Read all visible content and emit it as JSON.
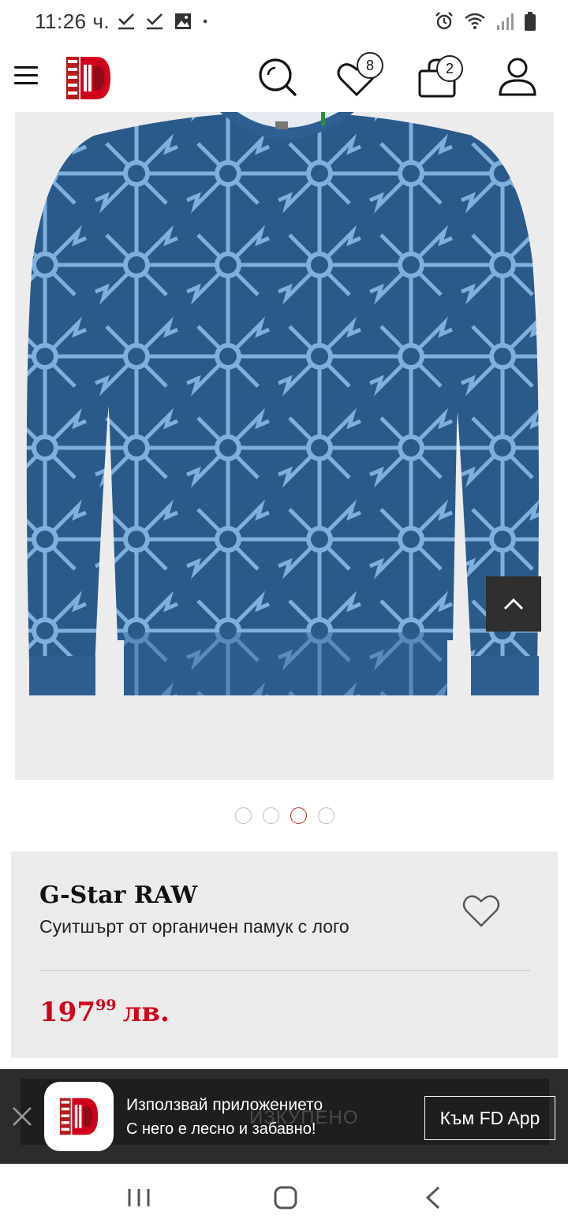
{
  "status_bar": {
    "time": "11:26 ч.",
    "left_icons": [
      "check-download-icon",
      "check-download-icon",
      "image-icon",
      "dot-icon"
    ],
    "right_icons": [
      "alarm-icon",
      "wifi-icon",
      "signal-icon",
      "battery-icon"
    ]
  },
  "header": {
    "wishlist_count": "8",
    "cart_count": "2",
    "icons": [
      "menu-icon",
      "logo",
      "search-icon",
      "heart-icon",
      "bag-icon",
      "user-icon"
    ]
  },
  "gallery": {
    "total_slides": 4,
    "active_slide": 3
  },
  "product": {
    "brand": "G-Star RAW",
    "name": "Суитшърт от органичен памук с лого",
    "price_main": "197",
    "price_cents": "99",
    "currency": "лв."
  },
  "app_banner": {
    "title": "Използвай приложението",
    "subtitle": "С него е лесно и забавно!",
    "button": "Към FD App",
    "ghost_text": "ИЗКУПЕНО"
  },
  "colors": {
    "accent": "#d0021b",
    "banner_bg": "#2c2c2c",
    "card_bg": "#ebebeb"
  }
}
